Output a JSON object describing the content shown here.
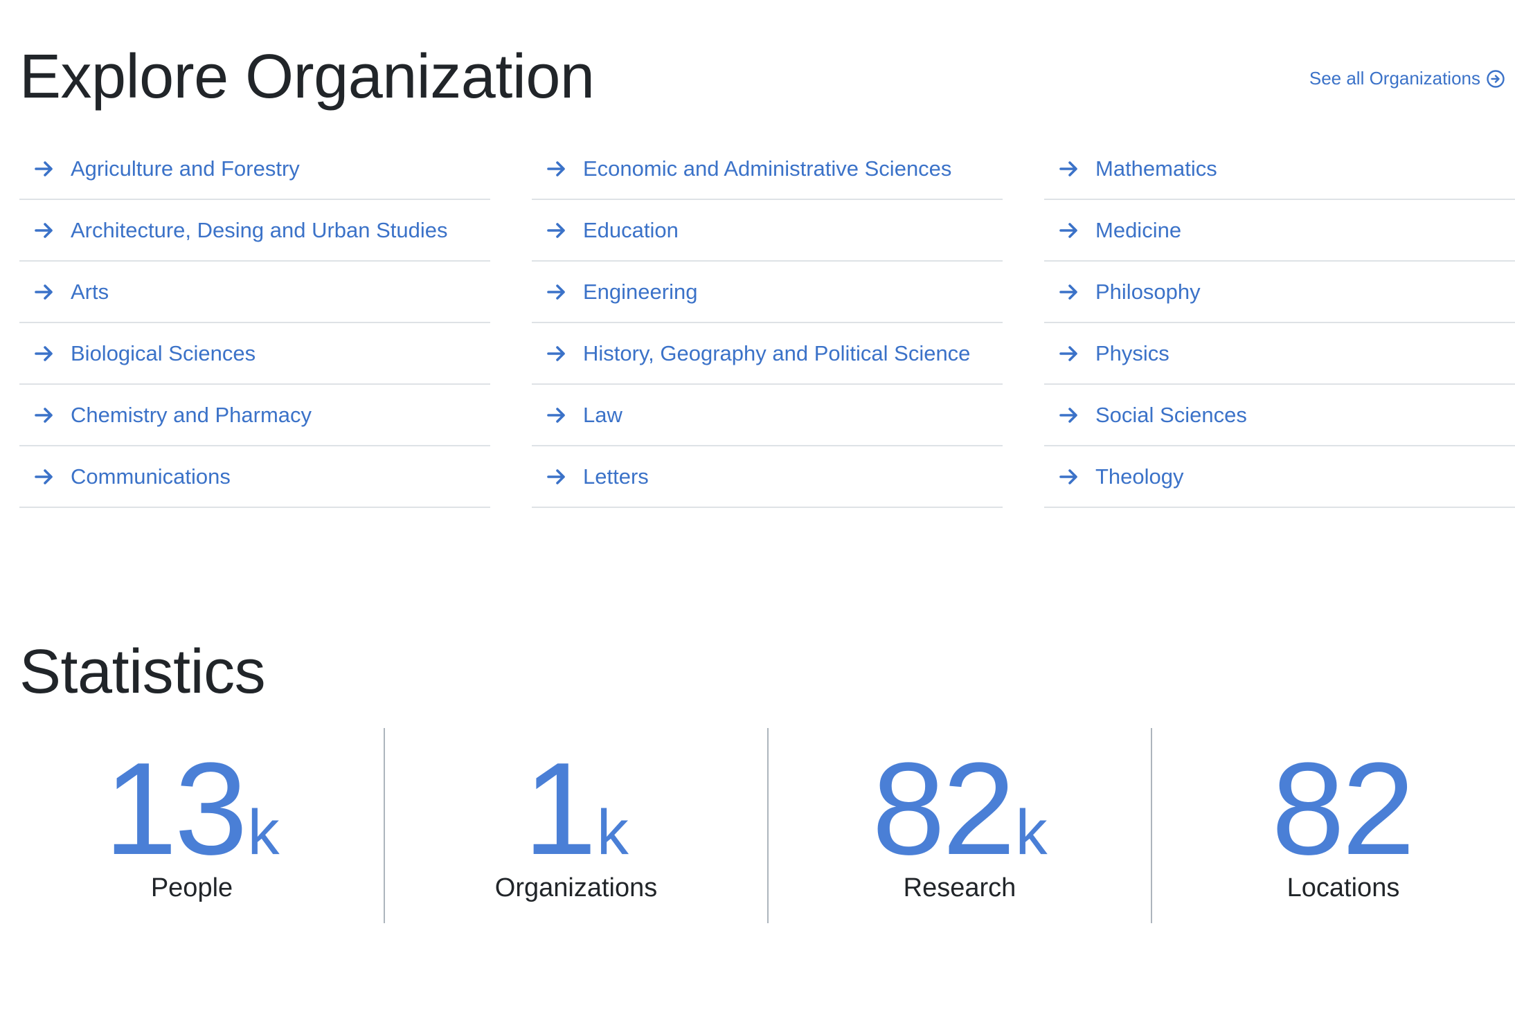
{
  "explore": {
    "title": "Explore Organization",
    "see_all_label": "See all Organizations",
    "columns": [
      [
        "Agriculture and Forestry",
        "Architecture, Desing and Urban Studies",
        "Arts",
        "Biological Sciences",
        "Chemistry and Pharmacy",
        "Communications"
      ],
      [
        "Economic and Administrative Sciences",
        "Education",
        "Engineering",
        "History, Geography and Political Science",
        "Law",
        "Letters"
      ],
      [
        "Mathematics",
        "Medicine",
        "Philosophy",
        "Physics",
        "Social Sciences",
        "Theology"
      ]
    ]
  },
  "statistics": {
    "title": "Statistics",
    "items": [
      {
        "value": "13",
        "unit": "k",
        "label": "People"
      },
      {
        "value": "1",
        "unit": "k",
        "label": "Organizations"
      },
      {
        "value": "82",
        "unit": "k",
        "label": "Research"
      },
      {
        "value": "82",
        "unit": "",
        "label": "Locations"
      }
    ]
  },
  "colors": {
    "link": "#3b72c8",
    "stat_value": "#4a7fd6",
    "text": "#212529",
    "divider": "#dee2e6"
  },
  "icons": {
    "item_icon": "arrow-right-icon",
    "see_all_icon": "arrow-right-circle-icon"
  }
}
